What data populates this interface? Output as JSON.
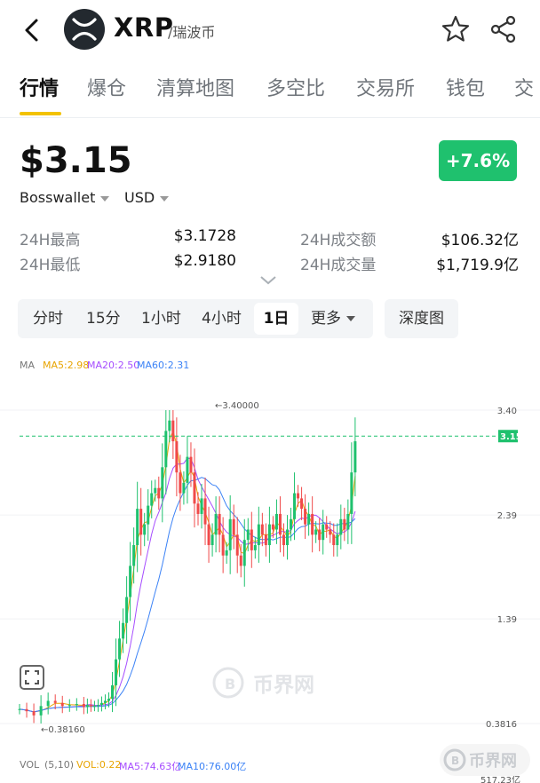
{
  "header": {
    "coin_symbol": "XRP",
    "coin_name": "/瑞波币",
    "icons": [
      "back-arrow-icon",
      "xrp-logo-icon",
      "star-icon",
      "share-icon"
    ]
  },
  "tabs": [
    {
      "label": "行情",
      "active": true
    },
    {
      "label": "爆仓"
    },
    {
      "label": "清算地图"
    },
    {
      "label": "多空比"
    },
    {
      "label": "交易所"
    },
    {
      "label": "钱包"
    },
    {
      "label": "交"
    }
  ],
  "price": {
    "value": "$3.15",
    "change": "+7.6%",
    "exchange": "Bosswallet",
    "currency": "USD"
  },
  "stats": [
    {
      "label": "24H最高",
      "value": "$3.1728"
    },
    {
      "label": "24H最低",
      "value": "$2.9180"
    },
    {
      "label": "24H成交额",
      "value": "$106.32亿"
    },
    {
      "label": "24H成交量",
      "value": "$1,719.9亿"
    }
  ],
  "intervals": {
    "items": [
      "分时",
      "15分",
      "1小时",
      "4小时",
      "1日",
      "更多"
    ],
    "active": "1日",
    "depth": "深度图"
  },
  "ma_legend": {
    "label": "MA",
    "ma5": "MA5:2.98",
    "ma20": "MA20:2.50",
    "ma60": "MA60:2.31"
  },
  "vol_legend": {
    "label": "VOL",
    "params": "(5,10)",
    "vol": "VOL:0.22",
    "ma5": "MA5:74.63亿",
    "ma10": "MA10:76.00亿"
  },
  "chart_data": {
    "type": "line",
    "axis_labels": [
      "3.40",
      "2.39",
      "1.39",
      "0.3816"
    ],
    "current_price": "3.15",
    "high_marker": "←3.40000",
    "low_marker": "←0.38160",
    "volume_axis_label": "517.23亿",
    "ylim": [
      0.3816,
      3.4
    ],
    "x": [
      0,
      8,
      16,
      24,
      32,
      40,
      48,
      56,
      64,
      72,
      76,
      80,
      84,
      88,
      92,
      96,
      100,
      104,
      108,
      112,
      116,
      120,
      124,
      128,
      132,
      136,
      140,
      144,
      148,
      152,
      156,
      160,
      164,
      168,
      172,
      176,
      180,
      184,
      188,
      192,
      196,
      200,
      204,
      208,
      212,
      216,
      220,
      224,
      228,
      232,
      236,
      240,
      244,
      248,
      252,
      256,
      260,
      264,
      268,
      272,
      276,
      280,
      284,
      288,
      292,
      296,
      300,
      304,
      308,
      312,
      316,
      320,
      324,
      328,
      332,
      336,
      340,
      344,
      348,
      352,
      356,
      360,
      364,
      368,
      372,
      376,
      380,
      384,
      388,
      392,
      396,
      400
    ],
    "close": [
      0.52,
      0.5,
      0.46,
      0.55,
      0.6,
      0.58,
      0.55,
      0.56,
      0.57,
      0.54,
      0.56,
      0.55,
      0.55,
      0.56,
      0.58,
      0.6,
      0.62,
      0.75,
      1.0,
      1.2,
      1.35,
      1.6,
      1.9,
      2.1,
      2.45,
      2.2,
      2.3,
      2.48,
      2.6,
      2.65,
      2.55,
      2.85,
      3.2,
      3.3,
      3.1,
      2.8,
      2.6,
      2.7,
      2.95,
      2.8,
      2.5,
      2.4,
      2.55,
      2.3,
      2.1,
      2.2,
      2.4,
      2.2,
      2.0,
      2.05,
      2.35,
      2.2,
      2.0,
      1.9,
      2.15,
      2.25,
      2.05,
      2.1,
      2.3,
      2.2,
      2.1,
      2.3,
      2.25,
      2.4,
      2.2,
      2.1,
      2.25,
      2.35,
      2.6,
      2.55,
      2.45,
      2.3,
      2.4,
      2.2,
      2.25,
      2.15,
      2.3,
      2.25,
      2.2,
      2.1,
      2.2,
      2.35,
      2.25,
      2.4,
      2.8,
      3.1
    ],
    "ma_series": [
      {
        "name": "MA5",
        "color": "#e8a400"
      },
      {
        "name": "MA20",
        "color": "#a64dff"
      },
      {
        "name": "MA60",
        "color": "#3b82f6"
      }
    ],
    "colors": {
      "up": "#1fc16e",
      "down": "#f04a4a",
      "dash": "#1fc16e"
    }
  },
  "watermarks": [
    "币界网",
    "币界网"
  ]
}
